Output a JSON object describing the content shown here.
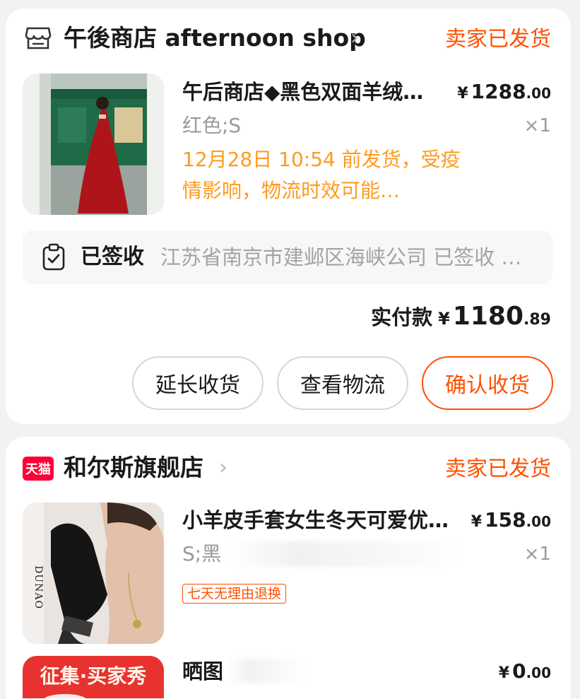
{
  "orders": [
    {
      "shop_name": "午後商店 afternoon shop",
      "shop_icon": "store-icon",
      "status": "卖家已发货",
      "product": {
        "title": "午后商店◆黑色双面羊绒…",
        "price_symbol": "¥",
        "price_int": "1288",
        "price_dec": ".00",
        "sku": "红色;S",
        "qty": "×1",
        "ship_note": "12月28日 10:54 前发货，受疫情影响，物流时效可能…"
      },
      "logistics": {
        "label": "已签收",
        "text": "江苏省南京市建邺区海峡公司 已签收 …",
        "icon": "clipboard-check-icon"
      },
      "paid": {
        "label": "实付款",
        "symbol": "¥",
        "int": "1180",
        "dec": ".89"
      },
      "buttons": {
        "extend": "延长收货",
        "track": "查看物流",
        "confirm": "确认收货"
      }
    },
    {
      "shop_name": "和尔斯旗舰店",
      "shop_logo_text": "天猫",
      "status": "卖家已发货",
      "product": {
        "title": "小羊皮手套女生冬天可爱优…",
        "price_symbol": "¥",
        "price_int": "158",
        "price_dec": ".00",
        "sku": "S;黑",
        "qty": "×1",
        "tag": "七天无理由退换",
        "image_brand": "DUNAO"
      },
      "gift": {
        "title": "晒图",
        "price_symbol": "¥",
        "price_int": "0",
        "price_dec": ".00",
        "image_text": "征集·买家秀"
      }
    }
  ],
  "colors": {
    "accent": "#ff5000",
    "ship_note": "#ff9a1f",
    "tmall": "#ff0036"
  }
}
